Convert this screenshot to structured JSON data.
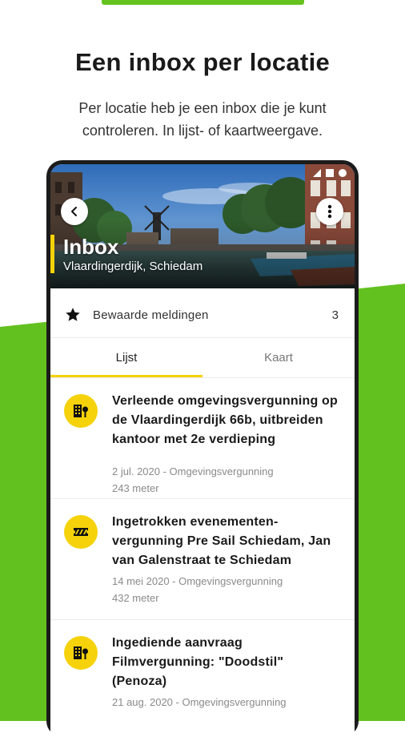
{
  "headline": "Een inbox per locatie",
  "subline_1": "Per locatie heb je een inbox die je kunt",
  "subline_2": "controleren. In lijst- of kaartweergave.",
  "hero": {
    "title": "Inbox",
    "subtitle": "Vlaardingerdijk, Schiedam"
  },
  "saved": {
    "label": "Bewaarde meldingen",
    "count": "3"
  },
  "tabs": [
    {
      "label": "Lijst",
      "active": true
    },
    {
      "label": "Kaart",
      "active": false
    }
  ],
  "items": [
    {
      "icon": "building-permit-icon",
      "title": "Verleende omgevingsvergunning op de Vlaardingerdijk 66b, uitbreiden kantoor met 2e verdieping",
      "meta_1": "2 jul. 2020 - Omgevingsvergunning",
      "meta_2": "243 meter"
    },
    {
      "icon": "ticket-icon",
      "title": "Ingetrokken evenementen-vergunning Pre Sail Schiedam, Jan van Galenstraat te Schiedam",
      "meta_1": "14 mei 2020 - Omgevingsvergunning",
      "meta_2": "432 meter"
    },
    {
      "icon": "building-permit-icon",
      "title": "Ingediende aanvraag Filmvergunning: \"Doodstil\" (Penoza)",
      "meta_1": "21 aug. 2020 - Omgevingsvergunning",
      "meta_2": ""
    }
  ],
  "colors": {
    "brand_green": "#63c11f",
    "accent_yellow": "#f5d20a"
  }
}
